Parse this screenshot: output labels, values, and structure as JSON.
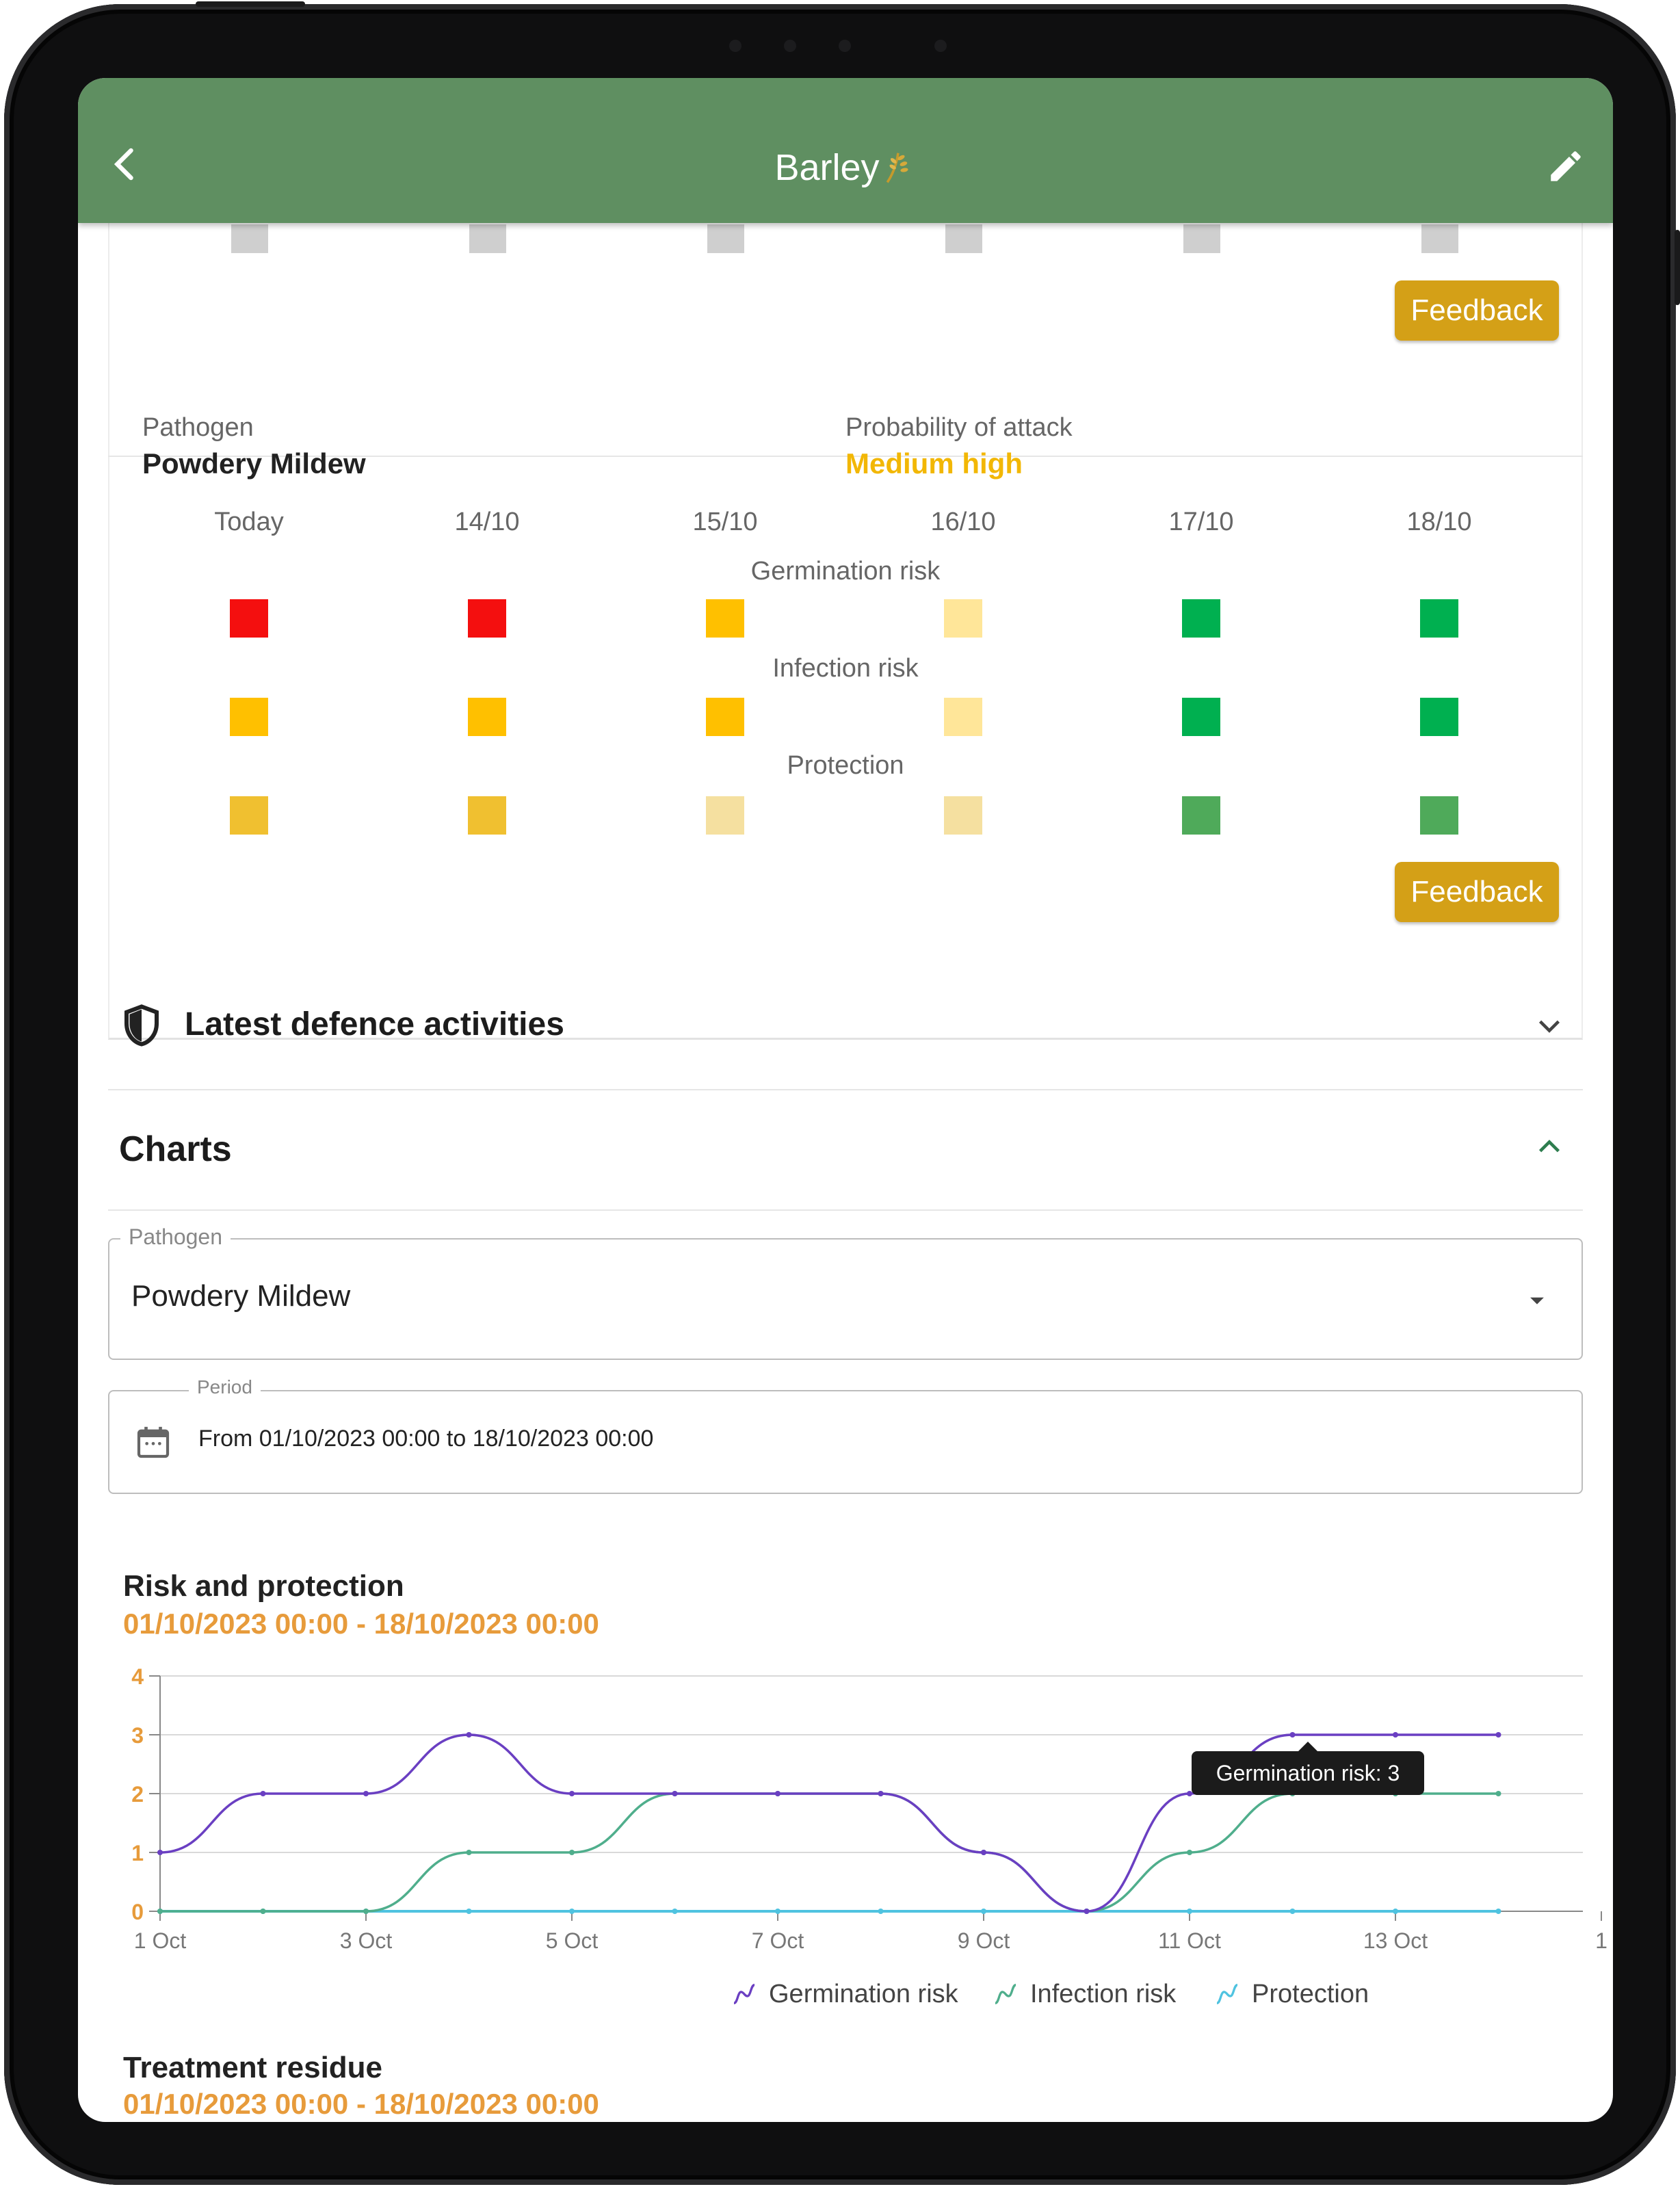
{
  "app": {
    "title": "Barley"
  },
  "feedback_label": "Feedback",
  "pathogen_block": {
    "pathogen_label": "Pathogen",
    "pathogen_value": "Powdery Mildew",
    "probability_label": "Probability of attack",
    "probability_value": "Medium high",
    "probability_color": "#f2b705",
    "days": [
      "Today",
      "14/10",
      "15/10",
      "16/10",
      "17/10",
      "18/10"
    ],
    "rows": [
      {
        "title": "Germination risk",
        "colors": [
          "#f40f0f",
          "#f40f0f",
          "#ffc000",
          "#ffe699",
          "#00b050",
          "#00b050"
        ]
      },
      {
        "title": "Infection risk",
        "colors": [
          "#ffc000",
          "#ffc000",
          "#ffc000",
          "#ffe699",
          "#00b050",
          "#00b050"
        ]
      },
      {
        "title": "Protection",
        "colors": [
          "#f0c030",
          "#f0c030",
          "#f5e0a0",
          "#f5e0a0",
          "#4faa5a",
          "#4faa5a"
        ]
      }
    ]
  },
  "sections": {
    "defence": "Latest defence activities",
    "charts": "Charts"
  },
  "filters": {
    "pathogen_label": "Pathogen",
    "pathogen_value": "Powdery Mildew",
    "period_label": "Period",
    "period_value": "From 01/10/2023 00:00 to 18/10/2023 00:00"
  },
  "chart1": {
    "title": "Risk and protection",
    "subtitle": "01/10/2023 00:00 - 18/10/2023 00:00",
    "tooltip": "Germination risk: 3"
  },
  "chart2": {
    "title": "Treatment residue",
    "subtitle": "01/10/2023 00:00 - 18/10/2023 00:00"
  },
  "chart_data": {
    "type": "line",
    "x": [
      "1 Oct",
      "2 Oct",
      "3 Oct",
      "4 Oct",
      "5 Oct",
      "6 Oct",
      "7 Oct",
      "8 Oct",
      "9 Oct",
      "10 Oct",
      "11 Oct",
      "12 Oct",
      "13 Oct",
      "14 Oct"
    ],
    "x_tick_labels": [
      "1 Oct",
      "3 Oct",
      "5 Oct",
      "7 Oct",
      "9 Oct",
      "11 Oct",
      "13 Oct",
      "1"
    ],
    "ylim": [
      0,
      4
    ],
    "y_ticks": [
      "0",
      "1",
      "2",
      "3",
      "4"
    ],
    "series": [
      {
        "name": "Germination risk",
        "color": "#6a3fc2",
        "values": [
          1,
          2,
          2,
          3,
          2,
          2,
          2,
          2,
          1,
          0,
          2,
          3,
          3,
          3
        ]
      },
      {
        "name": "Infection risk",
        "color": "#4fae8c",
        "values": [
          0,
          0,
          0,
          1,
          1,
          2,
          2,
          2,
          1,
          0,
          1,
          2,
          2,
          2
        ]
      },
      {
        "name": "Protection",
        "color": "#4fc3e0",
        "values": [
          0,
          0,
          0,
          0,
          0,
          0,
          0,
          0,
          0,
          0,
          0,
          0,
          0,
          0
        ]
      }
    ],
    "grid": true,
    "legend": "bottom"
  }
}
